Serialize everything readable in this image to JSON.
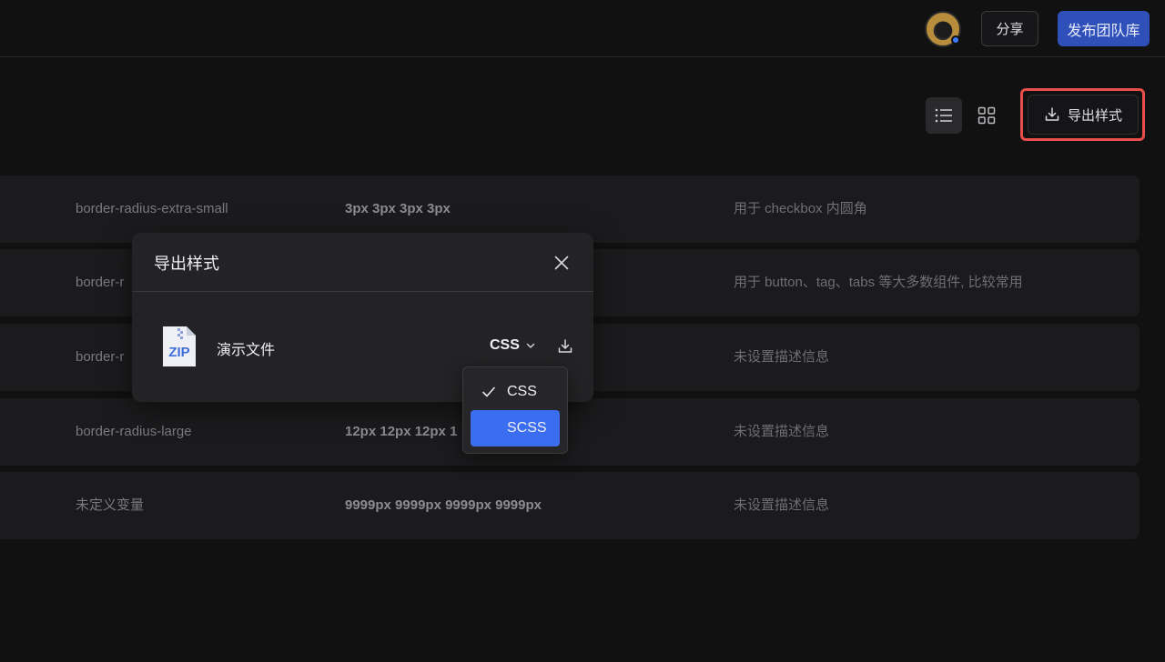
{
  "header": {
    "share_label": "分享",
    "publish_label": "发布团队库"
  },
  "toolbar": {
    "export_label": "导出样式"
  },
  "rows": [
    {
      "name": "border-radius-extra-small",
      "value": "3px 3px 3px 3px",
      "desc": "用于 checkbox 内圆角"
    },
    {
      "name": "border-r",
      "value": "",
      "desc": "用于 button、tag、tabs 等大多数组件, 比较常用"
    },
    {
      "name": "border-r",
      "value": "",
      "desc": "未设置描述信息"
    },
    {
      "name": "border-radius-large",
      "value": "12px 12px 12px 1",
      "desc": "未设置描述信息"
    },
    {
      "name": "未定义变量",
      "value": "9999px 9999px 9999px 9999px",
      "desc": "未设置描述信息"
    }
  ],
  "dialog": {
    "title": "导出样式",
    "file_name": "演示文件",
    "format_selected": "CSS",
    "zip_label": "ZIP"
  },
  "format_options": [
    "CSS",
    "SCSS"
  ],
  "colors": {
    "accent": "#3a6df0",
    "publish": "#2f4fb9",
    "highlight": "#ea4e4a"
  }
}
